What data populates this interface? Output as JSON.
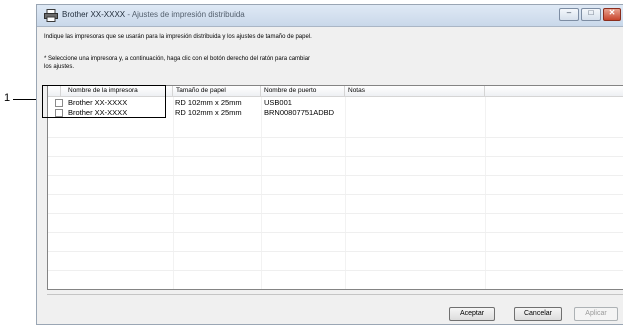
{
  "callout": {
    "label": "1"
  },
  "window": {
    "title_main": "Brother XX-XXXX",
    "title_sep": " - ",
    "title_sub": "Ajustes de impresión distribuida",
    "controls": {
      "minimize": "–",
      "maximize": "□",
      "close": "✕"
    }
  },
  "instructions": {
    "line1": "Indique las impresoras que se usarán para la impresión distribuida y los ajustes de tamaño de papel.",
    "line2": "* Seleccione una impresora y, a continuación, haga clic con el botón derecho del ratón para cambiar",
    "line3": "los ajustes."
  },
  "table": {
    "columns": [
      "Nombre de la impresora",
      "Tamaño de papel",
      "Nombre de puerto",
      "Notas"
    ],
    "rows": [
      {
        "checked": false,
        "printer": "Brother XX-XXXX",
        "paper": "RD 102mm x 25mm",
        "port": "USB001",
        "notes": ""
      },
      {
        "checked": false,
        "printer": "Brother XX-XXXX",
        "paper": "RD 102mm x 25mm",
        "port": "BRN00807751ADBD",
        "notes": ""
      }
    ]
  },
  "buttons": {
    "accept": "Aceptar",
    "cancel": "Cancelar",
    "apply": "Aplicar"
  }
}
